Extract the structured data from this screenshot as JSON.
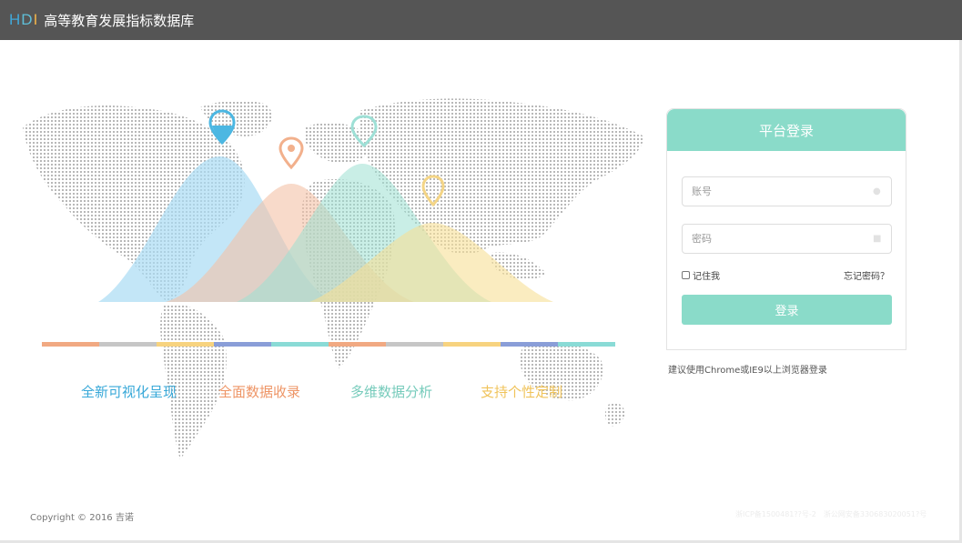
{
  "header": {
    "logo": {
      "h": "H",
      "d": "D",
      "i": "I"
    },
    "title": "高等教育发展指标数据库"
  },
  "strip_colors": [
    "#f1a982",
    "#c6c6c6",
    "#f7d37f",
    "#8a9ed8",
    "#8adbd6",
    "#f1a982",
    "#c6c6c6",
    "#f7d37f",
    "#8a9ed8",
    "#8adbd6"
  ],
  "features": [
    {
      "label": "全新可视化呈现",
      "color": "#37a8d8"
    },
    {
      "label": "全面数据收录",
      "color": "#ee9566"
    },
    {
      "label": "多维数据分析",
      "color": "#76cbbb"
    },
    {
      "label": "支持个性定制",
      "color": "#f0c35a"
    }
  ],
  "login": {
    "title": "平台登录",
    "username_placeholder": "账号",
    "password_placeholder": "密码",
    "remember_label": "记住我",
    "forgot_label": "忘记密码？",
    "submit_label": "登录"
  },
  "browser_hint": "建议使用Chrome或IE9以上浏览器登录",
  "footer": {
    "copyright": "Copyright © 2016 吉诺",
    "icp": "浙ICP备1500481??号-2　浙公网安备330683020051?号"
  }
}
